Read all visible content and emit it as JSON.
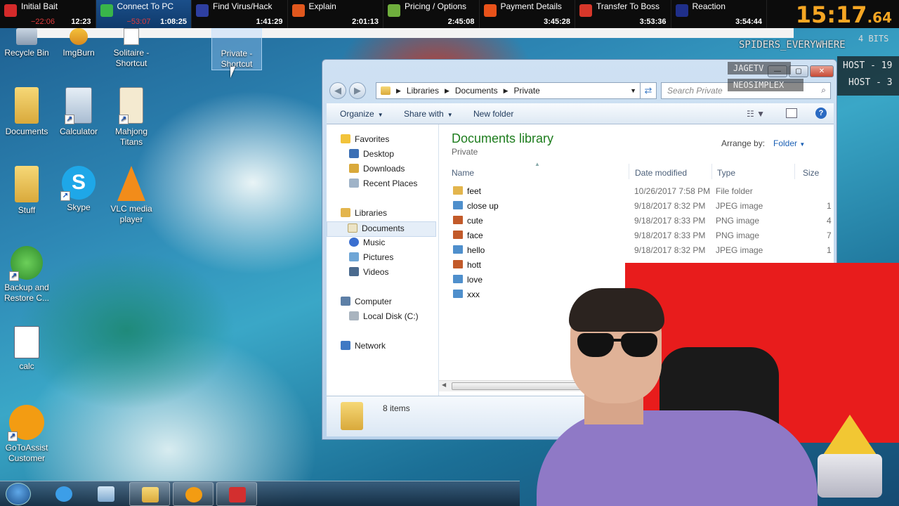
{
  "splits": [
    {
      "name": "Initial Bait",
      "delta": "−22:06",
      "time": "12:23",
      "color": "#d42a2a",
      "active": false
    },
    {
      "name": "Connect To PC",
      "delta": "−53:07",
      "time": "1:08:25",
      "color": "#39b54a",
      "active": true
    },
    {
      "name": "Find Virus/Hack",
      "delta": "",
      "time": "1:41:29",
      "color": "#2e3fa0",
      "active": false
    },
    {
      "name": "Explain",
      "delta": "",
      "time": "2:01:13",
      "color": "#e0571d",
      "active": false
    },
    {
      "name": "Pricing / Options",
      "delta": "",
      "time": "2:45:08",
      "color": "#6fae3d",
      "active": false
    },
    {
      "name": "Payment Details",
      "delta": "",
      "time": "3:45:28",
      "color": "#e8521a",
      "active": false
    },
    {
      "name": "Transfer To Boss",
      "delta": "",
      "time": "3:53:36",
      "color": "#d7372a",
      "active": false
    },
    {
      "name": "Reaction",
      "delta": "",
      "time": "3:54:44",
      "color": "#1f2f8a",
      "active": false
    }
  ],
  "timer": {
    "main": "15:17",
    "fraction": ".64"
  },
  "desktop": {
    "icons": [
      {
        "label": "Recycle Bin"
      },
      {
        "label": "ImgBurn"
      },
      {
        "label": "Solitaire - Shortcut"
      },
      {
        "label": "Private - Shortcut"
      },
      {
        "label": "Documents"
      },
      {
        "label": "Calculator"
      },
      {
        "label": "Mahjong Titans"
      },
      {
        "label": "Stuff"
      },
      {
        "label": "Skype"
      },
      {
        "label": "VLC media player"
      },
      {
        "label": "Backup and Restore C..."
      },
      {
        "label": "calc"
      },
      {
        "label": "GoToAssist Customer"
      }
    ]
  },
  "explorer": {
    "breadcrumb": [
      "Libraries",
      "Documents",
      "Private"
    ],
    "search_placeholder": "Search Private",
    "commands": {
      "organize": "Organize",
      "share": "Share with",
      "new_folder": "New folder"
    },
    "nav": {
      "favorites": "Favorites",
      "desktop": "Desktop",
      "downloads": "Downloads",
      "recent": "Recent Places",
      "libraries": "Libraries",
      "documents": "Documents",
      "music": "Music",
      "pictures": "Pictures",
      "videos": "Videos",
      "computer": "Computer",
      "local_disk": "Local Disk (C:)",
      "network": "Network"
    },
    "library_title": "Documents library",
    "library_subtitle": "Private",
    "arrange_label": "Arrange by:",
    "arrange_value": "Folder",
    "columns": {
      "name": "Name",
      "date": "Date modified",
      "type": "Type",
      "size": "Size"
    },
    "files": [
      {
        "name": "feet",
        "date": "10/26/2017 7:58 PM",
        "type": "File folder",
        "size": "",
        "kind": "folder"
      },
      {
        "name": "close up",
        "date": "9/18/2017 8:32 PM",
        "type": "JPEG image",
        "size": "1",
        "kind": "jpeg"
      },
      {
        "name": "cute",
        "date": "9/18/2017 8:33 PM",
        "type": "PNG image",
        "size": "4",
        "kind": "png"
      },
      {
        "name": "face",
        "date": "9/18/2017 8:33 PM",
        "type": "PNG image",
        "size": "7",
        "kind": "png"
      },
      {
        "name": "hello",
        "date": "9/18/2017 8:32 PM",
        "type": "JPEG image",
        "size": "1",
        "kind": "jpeg"
      },
      {
        "name": "hott",
        "date": "",
        "type": "",
        "size": "",
        "kind": "png"
      },
      {
        "name": "love",
        "date": "",
        "type": "",
        "size": "",
        "kind": "jpeg"
      },
      {
        "name": "xxx",
        "date": "",
        "type": "",
        "size": "",
        "kind": "jpeg"
      }
    ],
    "item_count": "8 items"
  },
  "overlay": {
    "bits": "4 BITS",
    "spiders": "SPIDERS_EVERYWHERE",
    "jagetv": "JAGETV",
    "neosimplex": "NEOSIMPLEX",
    "host1": "HOST - 19",
    "host2": "HOST - 3"
  }
}
